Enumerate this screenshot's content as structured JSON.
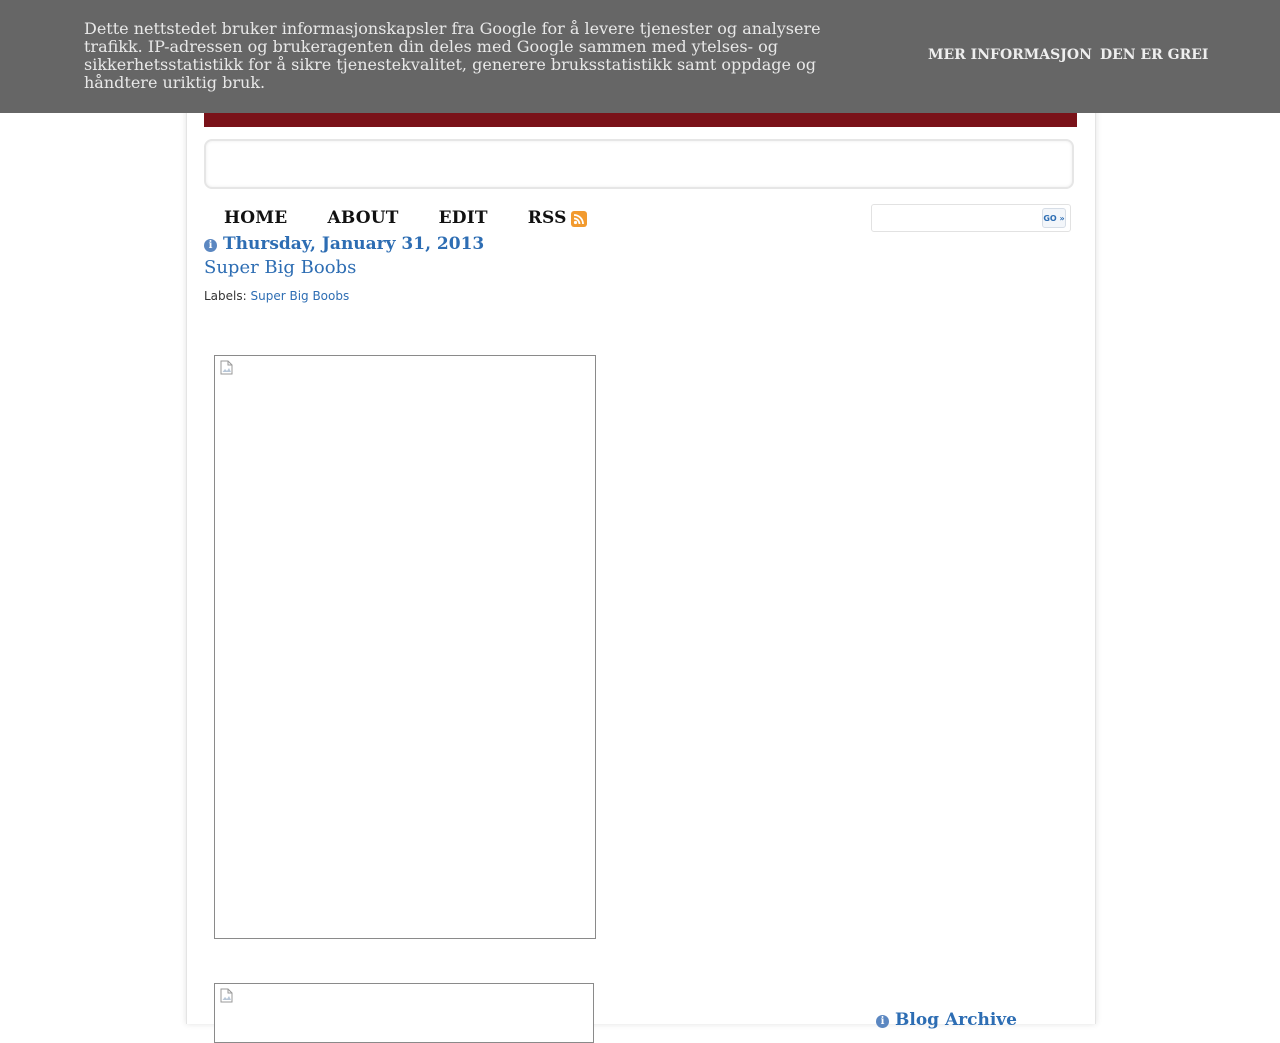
{
  "cookie_banner": {
    "text": "Dette nettstedet bruker informasjonskapsler fra Google for å levere tjenester og analysere trafikk. IP-adressen og brukeragenten din deles med Google sammen med ytelses- og sikkerhetsstatistikk for å sikre tjenestekvalitet, generere bruksstatistikk samt oppdage og håndtere uriktig bruk.",
    "more_info_label": "MER INFORMASJON",
    "accept_label": "DEN ER GREI"
  },
  "colors": {
    "header_bar": "#7a1219",
    "link_blue": "#2d6db3",
    "banner_bg": "#666666"
  },
  "nav": {
    "items": [
      {
        "label": "HOME"
      },
      {
        "label": "ABOUT"
      },
      {
        "label": "EDIT"
      },
      {
        "label": "RSS",
        "icon": "rss-icon"
      }
    ]
  },
  "search": {
    "placeholder": "",
    "go_label": "GO »"
  },
  "post": {
    "date": "Thursday, January 31, 2013",
    "title": "Super Big Boobs",
    "labels_prefix": "Labels: ",
    "label_link": "Super Big Boobs",
    "images": [
      {
        "icon": "broken-image-icon"
      },
      {
        "icon": "broken-image-icon"
      }
    ]
  },
  "sidebar": {
    "archive_title": "Blog Archive"
  }
}
